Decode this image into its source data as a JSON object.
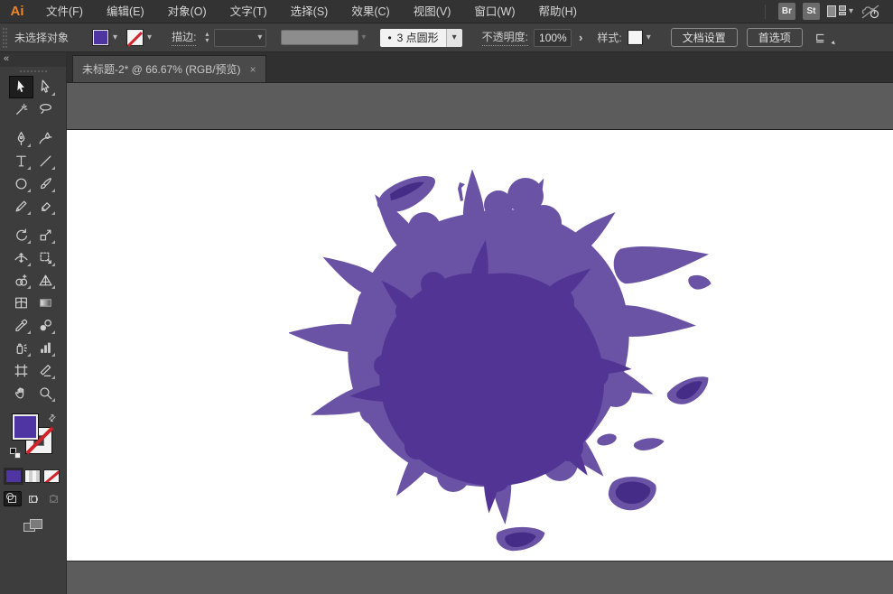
{
  "app": {
    "logo": "Ai"
  },
  "menu_bar": {
    "items": [
      "文件(F)",
      "编辑(E)",
      "对象(O)",
      "文字(T)",
      "选择(S)",
      "效果(C)",
      "视图(V)",
      "窗口(W)",
      "帮助(H)"
    ],
    "bridge_button": "Br",
    "stock_button": "St"
  },
  "control_bar": {
    "no_selection": "未选择对象",
    "stroke_label": "描边:",
    "brush_preview_dot": "•",
    "brush_name": "3 点圆形",
    "opacity_label": "不透明度:",
    "opacity_value": "100%",
    "style_label": "样式:",
    "document_setup_button": "文档设置",
    "preferences_button": "首选项"
  },
  "document_tab": {
    "title": "未标题-2* @ 66.67% (RGB/预览)",
    "zoom_level": "66.67%",
    "color_mode": "RGB/预览",
    "unsaved_indicator": "*"
  },
  "toolbar": {
    "tools": [
      "selection",
      "direct-selection",
      "magic-wand",
      "lasso",
      "pen",
      "curvature",
      "type",
      "line-segment",
      "ellipse",
      "paintbrush",
      "shaper",
      "eraser",
      "rotate",
      "scale",
      "width",
      "free-transform",
      "shape-builder",
      "perspective-grid",
      "mesh",
      "gradient",
      "eyedropper",
      "blend",
      "symbol-sprayer",
      "column-graph",
      "artboard",
      "slice",
      "hand",
      "zoom"
    ],
    "active_tool": "selection"
  },
  "icons": {
    "chevron_down": "▾",
    "chevron_up": "▴",
    "close": "×",
    "collapse": "«",
    "expander": "›",
    "swap": "⇄"
  },
  "artwork": {
    "subject": "ink-splat"
  },
  "colors": {
    "menubar": "#333333",
    "controlbar": "#404040",
    "tab": "#4a4a4a",
    "panel": "#3d3d3d",
    "pasteboard": "#5c5c5c",
    "artboard": "#ffffff",
    "accent_orange": "#e8862d",
    "swatch_purple": "#4f35a3",
    "slash_red": "#d2232a",
    "splat_outer": "#6a52a5",
    "splat_inner": "#513494",
    "splat_accent": "#452c86"
  }
}
